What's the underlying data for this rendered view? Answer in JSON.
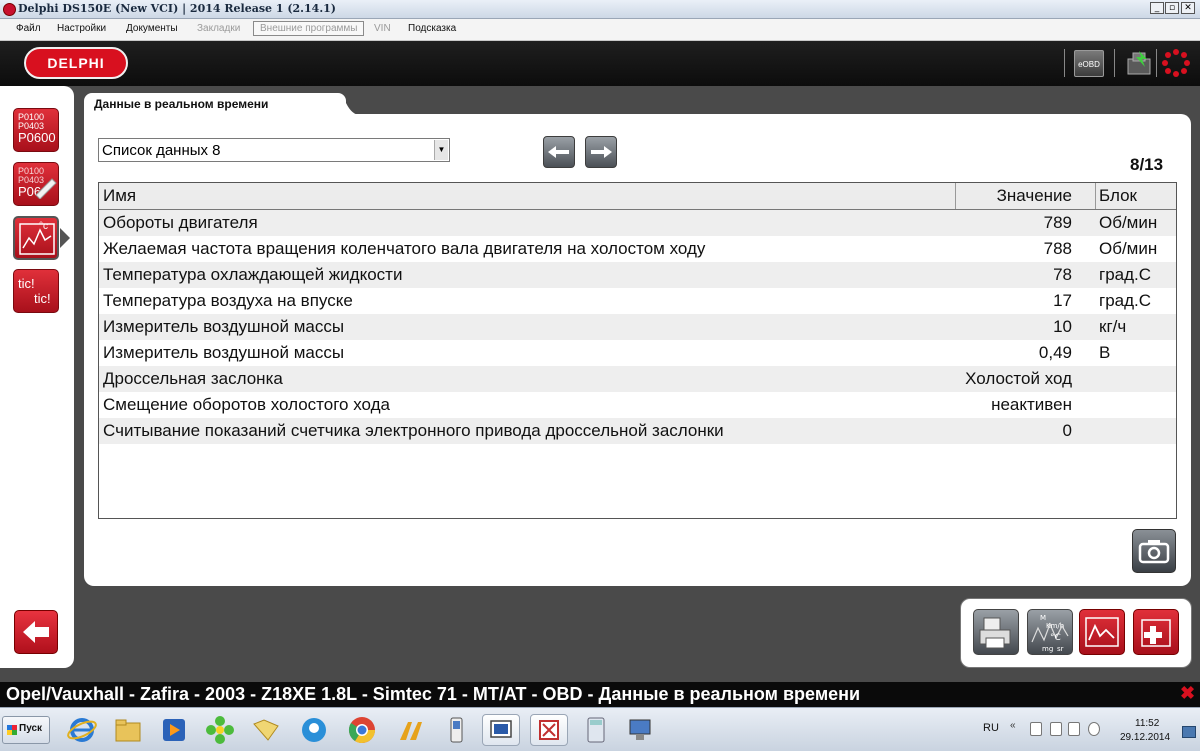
{
  "window": {
    "title": "Delphi DS150E (New VCI) | 2014 Release 1 (2.14.1)",
    "minimize": "_",
    "maximize": "▫",
    "close": "✕"
  },
  "menu": {
    "items": [
      "Файл",
      "Настройки",
      "Документы",
      "Закладки",
      "Внешние программы",
      "VIN",
      "Подсказка"
    ]
  },
  "header": {
    "logo": "DELPHI",
    "eobd_label": "eOBD",
    "icons": [
      "connection-status-icon",
      "settings-gear-icon"
    ]
  },
  "sidebar": {
    "icons": [
      {
        "name": "fault-codes-icon",
        "lines": [
          "P0100",
          "P0403",
          "P0600"
        ]
      },
      {
        "name": "clear-codes-icon",
        "lines": [
          "P0100",
          "P0403",
          "P06"
        ]
      },
      {
        "name": "live-data-icon",
        "lines": [
          "°c"
        ]
      },
      {
        "name": "actuator-test-icon",
        "lines": [
          "tic!",
          "tic!"
        ]
      }
    ],
    "back": "back-arrow-icon"
  },
  "tab": {
    "label": "Данные в реальном времени"
  },
  "list_select": {
    "value": "Список данных 8"
  },
  "page_counter": "8/13",
  "table": {
    "headers": {
      "name": "Имя",
      "value": "Значение",
      "unit": "Блок"
    },
    "rows": [
      {
        "name": "Обороты двигателя",
        "value": "789",
        "unit": "Об/мин"
      },
      {
        "name": "Желаемая частота вращения коленчатого вала двигателя на холостом ходу",
        "value": "788",
        "unit": "Об/мин"
      },
      {
        "name": "Температура охлаждающей жидкости",
        "value": "78",
        "unit": "град.С"
      },
      {
        "name": "Температура воздуха на впуске",
        "value": "17",
        "unit": "град.С"
      },
      {
        "name": "Измеритель воздушной массы",
        "value": "10",
        "unit": "кг/ч"
      },
      {
        "name": "Измеритель воздушной массы",
        "value": "0,49",
        "unit": "В"
      },
      {
        "name": "Дроссельная заслонка",
        "value": "Холостой ход",
        "unit": ""
      },
      {
        "name": "Смещение оборотов холостого хода",
        "value": "неактивен",
        "unit": ""
      },
      {
        "name": "Считывание показаний счетчика электронного привода дроссельной заслонки",
        "value": "0",
        "unit": ""
      }
    ]
  },
  "tools": {
    "icons": [
      "print-icon",
      "units-icon",
      "graph-icon",
      "add-parameter-icon"
    ],
    "units_labels": [
      "M",
      "Km/h",
      "°C",
      "mg",
      "sr"
    ]
  },
  "status_bar": {
    "text": "Opel/Vauxhall - Zafira - 2003 - Z18XE 1.8L - Simtec 71 - MT/AT - OBD - Данные в реальном времени",
    "close": "✖"
  },
  "taskbar": {
    "start": "Пуск",
    "language": "RU",
    "tray_arrow": "«",
    "time": "11:52",
    "date": "29.12.2014"
  }
}
